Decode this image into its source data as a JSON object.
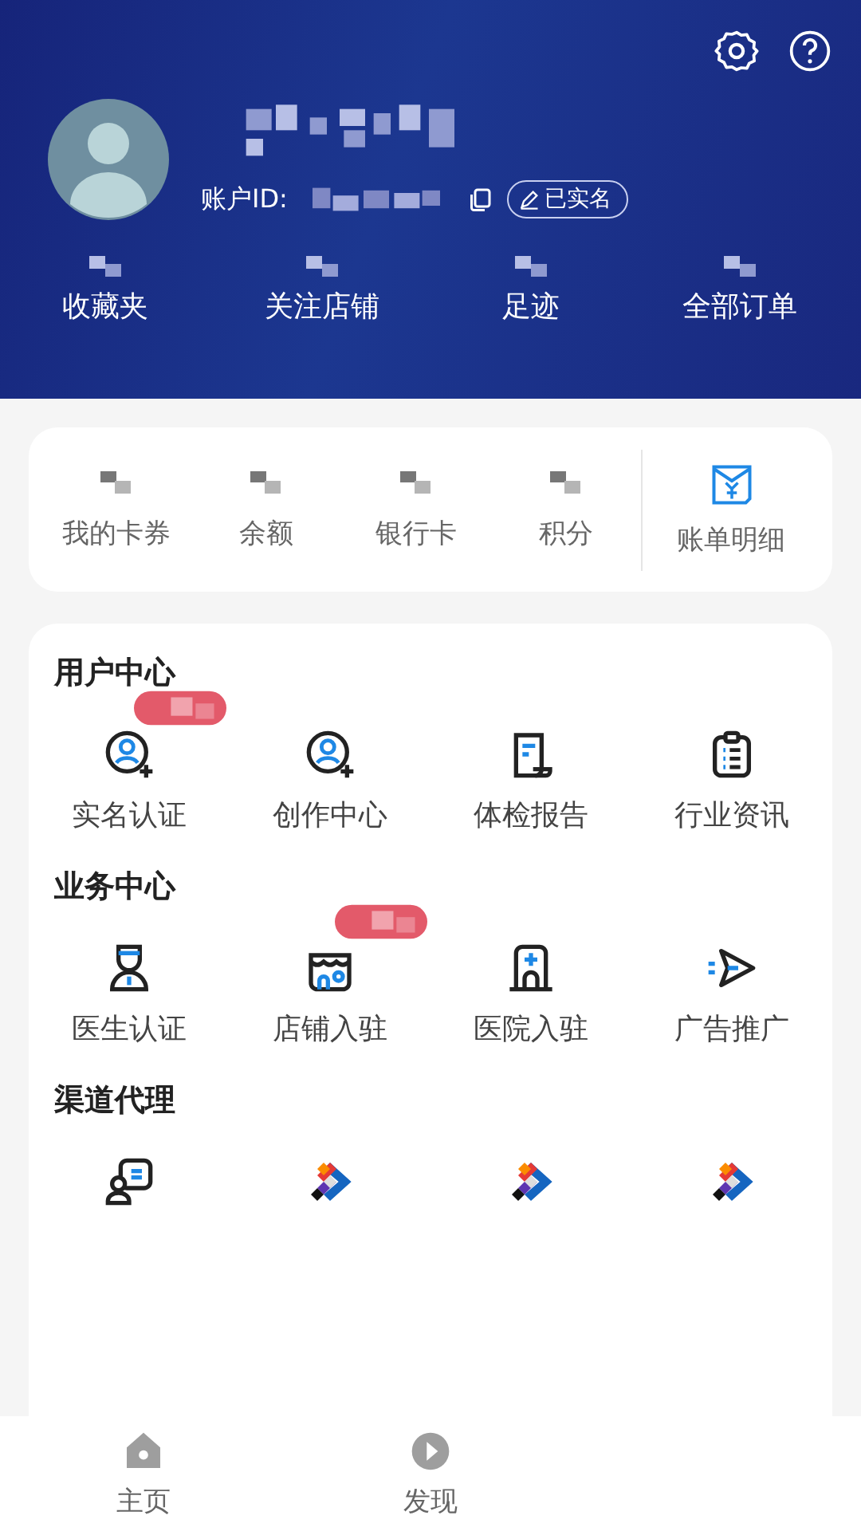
{
  "header": {
    "account_label": "账户ID:",
    "verified_tag": "已实名",
    "stats": [
      {
        "label": "收藏夹"
      },
      {
        "label": "关注店铺"
      },
      {
        "label": "足迹"
      },
      {
        "label": "全部订单"
      }
    ]
  },
  "wallet": {
    "items": [
      {
        "label": "我的卡券"
      },
      {
        "label": "余额"
      },
      {
        "label": "银行卡"
      },
      {
        "label": "积分"
      }
    ],
    "bill": {
      "label": "账单明细"
    }
  },
  "sections": [
    {
      "title": "用户中心",
      "items": [
        {
          "label": "实名认证",
          "badge": true
        },
        {
          "label": "创作中心",
          "badge": false
        },
        {
          "label": "体检报告",
          "badge": false
        },
        {
          "label": "行业资讯",
          "badge": false
        }
      ]
    },
    {
      "title": "业务中心",
      "items": [
        {
          "label": "医生认证",
          "badge": false
        },
        {
          "label": "店铺入驻",
          "badge": true
        },
        {
          "label": "医院入驻",
          "badge": false
        },
        {
          "label": "广告推广",
          "badge": false
        }
      ]
    },
    {
      "title": "渠道代理"
    }
  ],
  "nav": [
    {
      "label": "主页"
    },
    {
      "label": "发现"
    }
  ]
}
